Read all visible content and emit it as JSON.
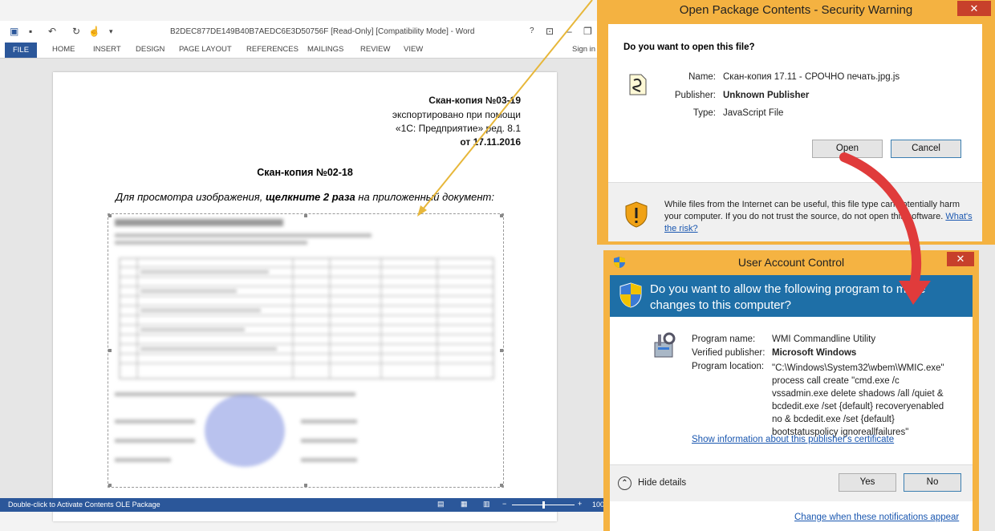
{
  "word": {
    "title": "B2DEC877DE149B40B7AEDC6E3D50756F [Read-Only] [Compatibility Mode] - Word",
    "tabs": [
      "FILE",
      "HOME",
      "INSERT",
      "DESIGN",
      "PAGE LAYOUT",
      "REFERENCES",
      "MAILINGS",
      "REVIEW",
      "VIEW"
    ],
    "sign_in": "Sign in",
    "help": "?",
    "doc": {
      "header_line1": "Скан-копия №03-19",
      "header_line2": "экспортировано при помощи",
      "header_line3": "«1С: Предприятие» ред. 8.1",
      "header_line4": "от 17.11.2016",
      "heading": "Скан-копия №02-18",
      "instr_a": "Для просмотра изображения, ",
      "instr_b": "щелкните 2 раза",
      "instr_c": " на приложенный документ:"
    },
    "status_text": "Double-click to Activate Contents OLE Package",
    "zoom": "100"
  },
  "security_warning": {
    "title": "Open Package Contents - Security Warning",
    "close": "✕",
    "question": "Do you want to open this file?",
    "name_label": "Name:",
    "name_value": "Скан-копия 17.11 - СРОЧНО печать.jpg.js",
    "publisher_label": "Publisher:",
    "publisher_value": "Unknown Publisher",
    "type_label": "Type:",
    "type_value": "JavaScript File",
    "open_button": "Open",
    "cancel_button": "Cancel",
    "warning_text": "While files from the Internet can be useful, this file type can potentially harm your computer. If you do not trust the source, do not open this software.",
    "risk_link": "What's the risk?"
  },
  "uac": {
    "title": "User Account Control",
    "close": "✕",
    "question": "Do you want to allow the following program to make changes to this computer?",
    "program_name_label": "Program name:",
    "program_name_value": "WMI Commandline Utility",
    "publisher_label": "Verified publisher:",
    "publisher_value": "Microsoft Windows",
    "location_label": "Program location:",
    "location_lines": [
      "\"C:\\Windows\\System32\\wbem\\WMIC.exe\"",
      "process call create \"cmd.exe /c",
      "vssadmin.exe delete shadows /all /quiet &",
      "bcdedit.exe /set {default} recoveryenabled",
      "no & bcdedit.exe /set {default}",
      "bootstatuspolicy ignoreallfailures\""
    ],
    "cert_link": "Show information about this publisher's certificate",
    "hide_details": "Hide details",
    "yes_button": "Yes",
    "no_button": "No",
    "change_link": "Change when these notifications appear"
  },
  "colors": {
    "word_blue": "#2b579a",
    "dialog_frame": "#f5b342",
    "uac_banner": "#1e6fa7",
    "close_red": "#c7402b",
    "arrow_red": "#e03b3b",
    "arrow_yellow": "#e7b73a"
  }
}
